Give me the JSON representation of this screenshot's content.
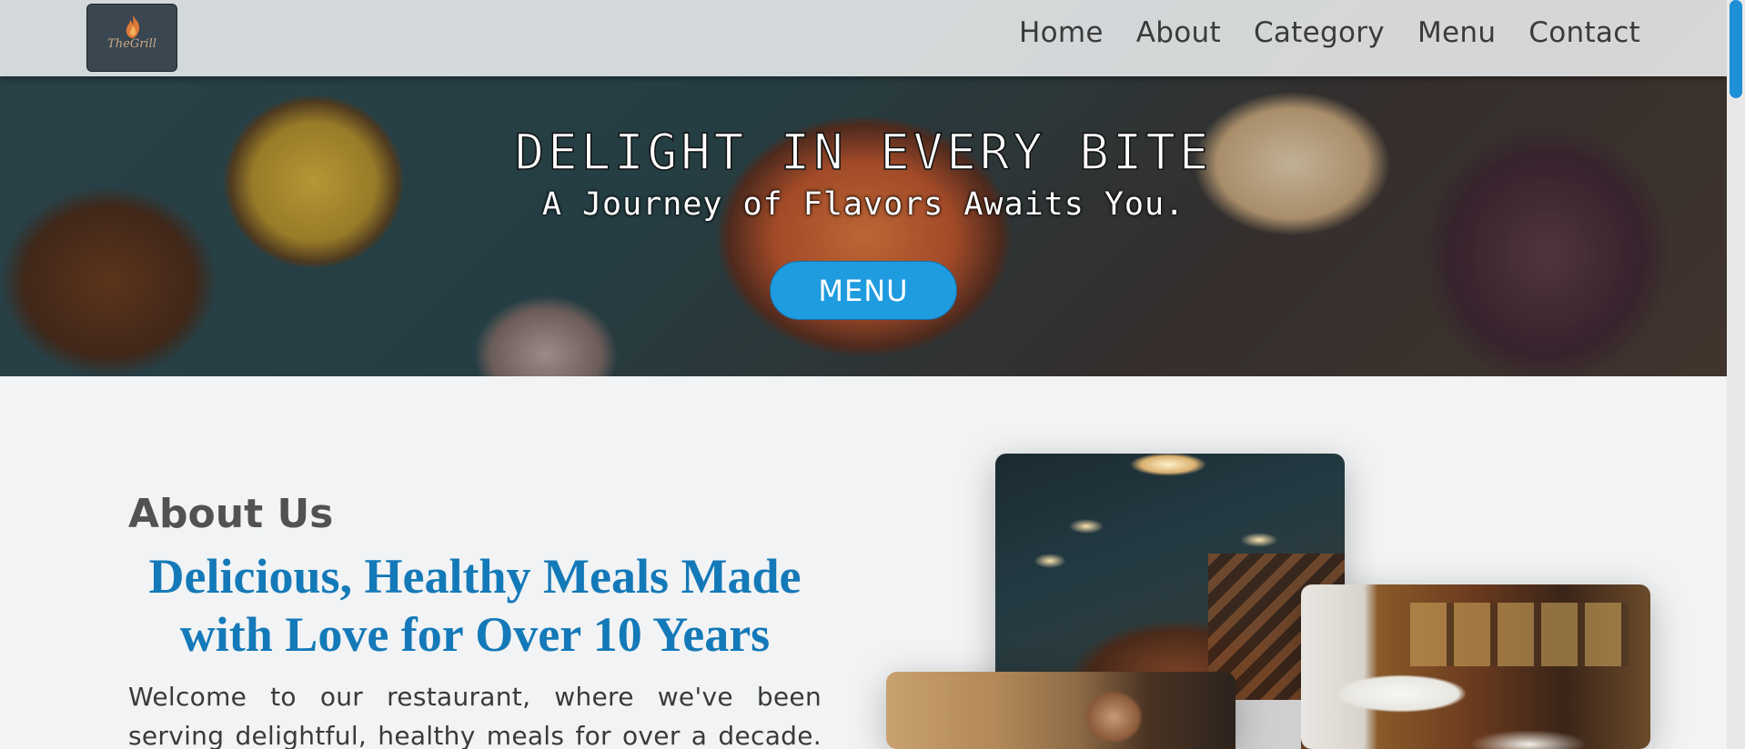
{
  "nav": {
    "logo_text": "TheGrill",
    "links": [
      "Home",
      "About",
      "Category",
      "Menu",
      "Contact"
    ]
  },
  "hero": {
    "title": "DELIGHT IN EVERY BITE",
    "subtitle": "A Journey of Flavors Awaits You.",
    "button_label": "MENU"
  },
  "about": {
    "heading": "About Us",
    "tagline": "Delicious, Healthy Meals Made with Love for Over 10 Years",
    "body": "Welcome to our restaurant, where we've been serving delightful, healthy meals for over a decade."
  },
  "colors": {
    "accent": "#1f9be0",
    "tagline": "#1479b8",
    "scroll_thumb": "#1f8fd6"
  },
  "icons": {
    "logo": "flame-icon"
  }
}
